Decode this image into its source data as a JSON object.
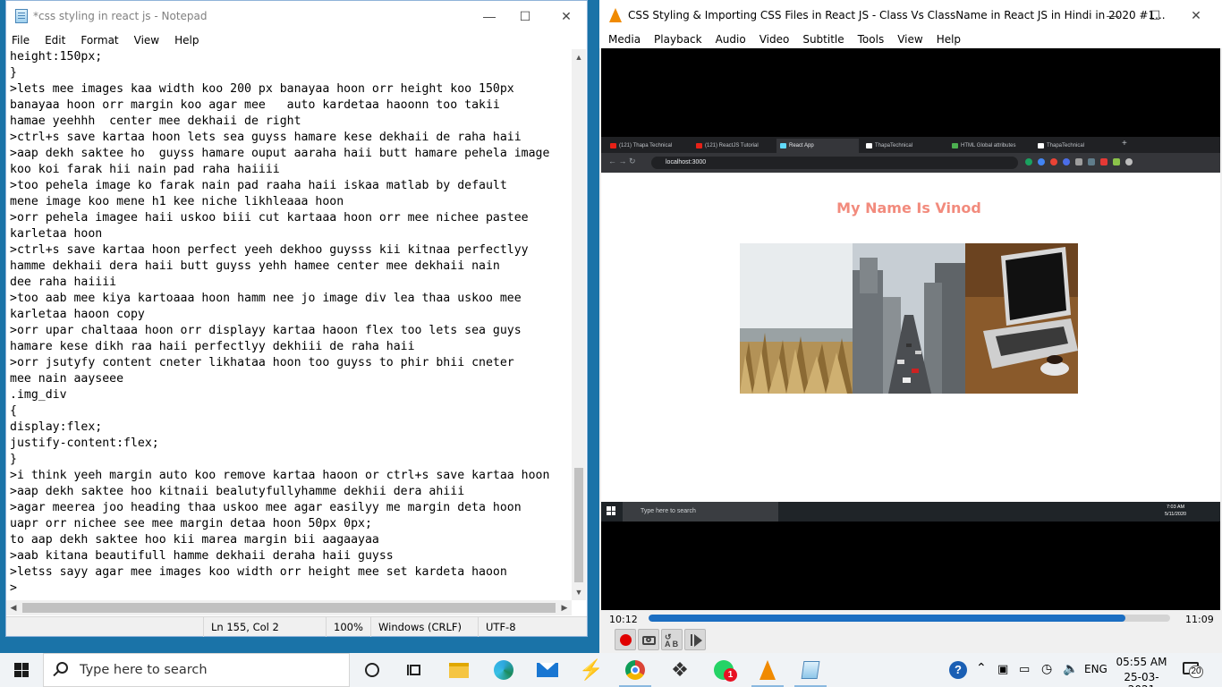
{
  "notepad": {
    "title": "*css styling in react js - Notepad",
    "menu": [
      "File",
      "Edit",
      "Format",
      "View",
      "Help"
    ],
    "lines": [
      "height:150px;",
      "}",
      ">lets mee images kaa width koo 200 px banayaa hoon orr height koo 150px",
      "banayaa hoon orr margin koo agar mee   auto kardetaa haoonn too takii",
      "hamae yeehhh  center mee dekhaii de right",
      ">ctrl+s save kartaa hoon lets sea guyss hamare kese dekhaii de raha haii",
      ">aap dekh saktee ho  guyss hamare ouput aaraha haii butt hamare pehela image",
      "koo koi farak hii nain pad raha haiiii",
      ">too pehela image ko farak nain pad raaha haii iskaa matlab by default",
      "mene image koo mene h1 kee niche likhleaaa hoon",
      ">orr pehela imagee haii uskoo biii cut kartaaa hoon orr mee nichee pastee",
      "karletaa hoon",
      ">ctrl+s save kartaa hoon perfect yeeh dekhoo guysss kii kitnaa perfectlyy",
      "hamme dekhaii dera haii butt guyss yehh hamee center mee dekhaii nain",
      "dee raha haiiii",
      ">too aab mee kiya kartoaaa hoon hamm nee jo image div lea thaa uskoo mee",
      "karletaa haoon copy",
      ">orr upar chaltaaa hoon orr displayy kartaa haoon flex too lets sea guys",
      "hamare kese dikh raa haii perfectlyy dekhiii de raha haii",
      ">orr jsutyfy content cneter likhataa hoon too guyss to phir bhii cneter",
      "mee nain aayseee",
      ".img_div",
      "{",
      "display:flex;",
      "justify-content:flex;",
      "}",
      ">i think yeeh margin auto koo remove kartaa haoon or ctrl+s save kartaa hoon",
      ">aap dekh saktee hoo kitnaii bealutyfullyhamme dekhii dera ahiii",
      ">agar meerea joo heading thaa uskoo mee agar easilyy me margin deta hoon",
      "uapr orr nichee see mee margin detaa hoon 50px 0px;",
      "to aap dekh saktee hoo kii marea margin bii aagaayaa",
      ">aab kitana beautifull hamme dekhaii deraha haii guyss",
      ">letss sayy agar mee images koo width orr height mee set kardeta haoon",
      ">"
    ],
    "status": {
      "position": "Ln 155, Col 2",
      "zoom": "100%",
      "line_ending": "Windows (CRLF)",
      "encoding": "UTF-8"
    }
  },
  "vlc": {
    "title": "CSS Styling & Importing CSS Files in React JS - Class Vs ClassName in React JS in Hindi in 2020 #1...",
    "menu": [
      "Media",
      "Playback",
      "Audio",
      "Video",
      "Subtitle",
      "Tools",
      "View",
      "Help"
    ],
    "elapsed": "10:12",
    "duration": "11:09",
    "progress": 0.915,
    "video_frame": {
      "tabs": [
        "(121) Thapa Technical",
        "(121) ReactJS Tutorial",
        "React App",
        "ThapaTechnical",
        "HTML Global attributes",
        "ThapaTechnical"
      ],
      "active_tab": 2,
      "url": "localhost:3000",
      "heading": "My Name Is Vinod",
      "search_placeholder": "Type here to search",
      "clock_time": "7:03 AM",
      "clock_date": "5/11/2020"
    }
  },
  "taskbar": {
    "search_placeholder": "Type here to search",
    "language": "ENG",
    "time": "05:55 AM",
    "date": "25-03-2021",
    "whatsapp_badge": "1",
    "notification_count": "20"
  },
  "colors": {
    "vlc_orange": "#f08a00",
    "seek_blue": "#1b6ec2",
    "record_red": "#e00000",
    "heading_salmon": "#f28b7d"
  }
}
